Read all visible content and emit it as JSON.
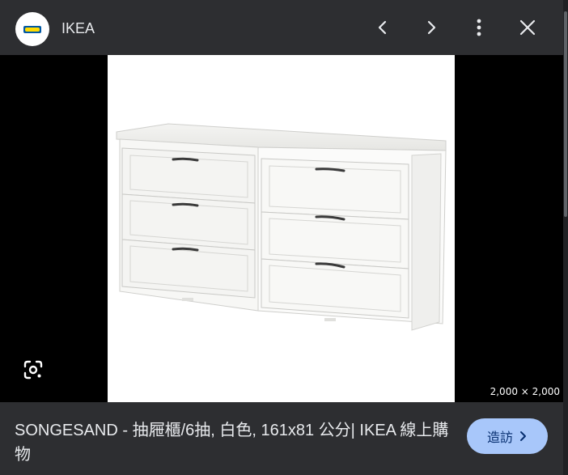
{
  "header": {
    "site_name": "IKEA",
    "logo_icon": "ikea-logo",
    "actions": {
      "previous_icon": "chevron-left-icon",
      "next_icon": "chevron-right-icon",
      "more_icon": "more-vert-icon",
      "close_icon": "close-icon"
    }
  },
  "viewer": {
    "image_subject": "white six-drawer dresser",
    "lens_icon": "google-lens-icon",
    "image_dimensions": "2,000 × 2,000"
  },
  "footer": {
    "title": "SONGESAND - 抽屜櫃/6抽, 白色, 161x81 公分| IKEA 線上購物",
    "visit_label": "造訪",
    "visit_icon": "chevron-right-icon"
  },
  "colors": {
    "header_bg": "#2d2e31",
    "viewer_bg": "#000000",
    "accent_button": "#a8c7fa",
    "ikea_blue": "#0058a3",
    "ikea_yellow": "#ffdb00"
  }
}
